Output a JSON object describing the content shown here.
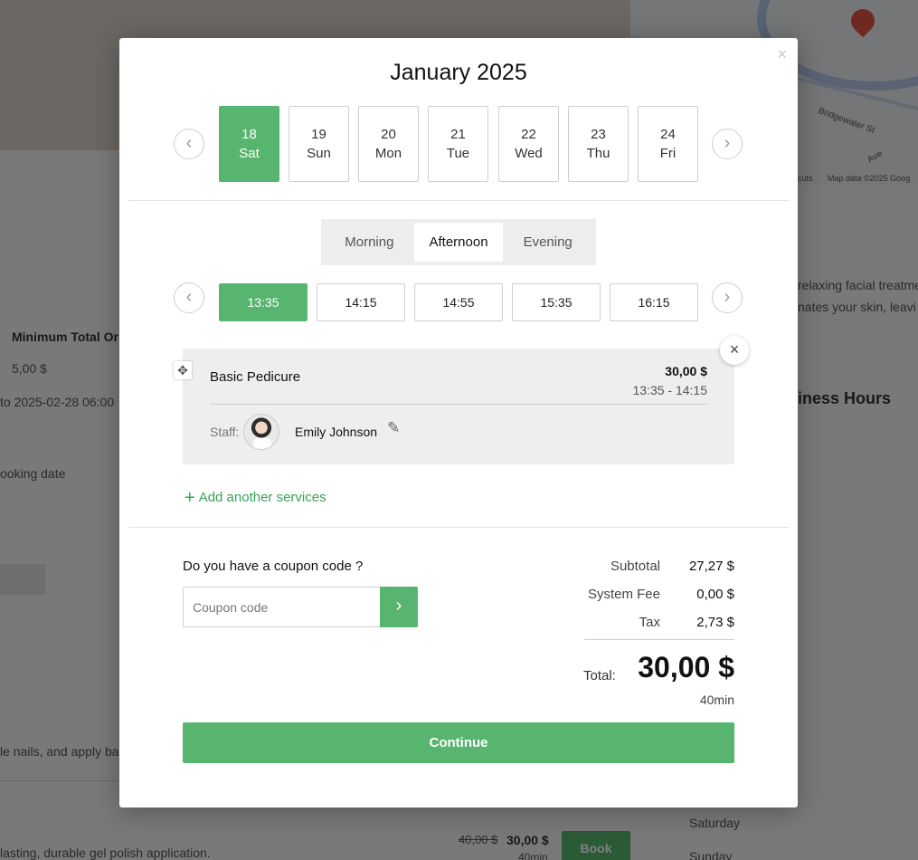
{
  "background": {
    "min_total_label": "Minimum Total Or",
    "min_total_value": "5,00 $",
    "date_range": "to 2025-02-28 06:00",
    "booking_date": "ooking date",
    "desc_right_1": "relaxing facial treatme",
    "desc_right_2": "nates your skin, leavi",
    "business_hours": "iness Hours",
    "nails_text": "le nails, and apply ba",
    "gel_text": "lasting, durable gel polish application.",
    "old_price": "40,00 $",
    "new_price": "30,00 $",
    "duration": "40min",
    "book_button": "Book",
    "saturday": "Saturday",
    "sunday": "Sunday",
    "map_credit": "Map data ©2025 Goog",
    "map_shortcuts": "cuts",
    "map_street_1": "Bridgewater St",
    "map_street_2": "Ave"
  },
  "modal": {
    "close_icon": "×",
    "month_title": "January 2025",
    "prev_icon": "‹",
    "next_icon": "›",
    "days": [
      {
        "num": "18",
        "dow": "Sat",
        "selected": true
      },
      {
        "num": "19",
        "dow": "Sun",
        "selected": false
      },
      {
        "num": "20",
        "dow": "Mon",
        "selected": false
      },
      {
        "num": "21",
        "dow": "Tue",
        "selected": false
      },
      {
        "num": "22",
        "dow": "Wed",
        "selected": false
      },
      {
        "num": "23",
        "dow": "Thu",
        "selected": false
      },
      {
        "num": "24",
        "dow": "Fri",
        "selected": false
      }
    ],
    "periods": [
      "Morning",
      "Afternoon",
      "Evening"
    ],
    "active_period": "Afternoon",
    "slots": [
      "13:35",
      "14:15",
      "14:55",
      "15:35",
      "16:15"
    ],
    "selected_slot": "13:35",
    "service": {
      "name": "Basic Pedicure",
      "price": "30,00 $",
      "time": "13:35 - 14:15",
      "staff_label": "Staff:",
      "staff_name": "Emily Johnson",
      "remove_icon": "×",
      "move_icon": "✥",
      "edit_icon": "✎"
    },
    "add_service_label": "Add another services",
    "coupon": {
      "question": "Do you have a coupon code ?",
      "placeholder": "Coupon code",
      "value": "",
      "submit_icon": "›"
    },
    "summary": {
      "subtotal_label": "Subtotal",
      "subtotal_value": "27,27 $",
      "fee_label": "System Fee",
      "fee_value": "0,00 $",
      "tax_label": "Tax",
      "tax_value": "2,73 $",
      "total_label": "Total:",
      "total_value": "30,00 $",
      "duration": "40min"
    },
    "continue_label": "Continue"
  },
  "colors": {
    "accent": "#57b56f",
    "overlay": "rgba(0,0,0,0.5)"
  }
}
